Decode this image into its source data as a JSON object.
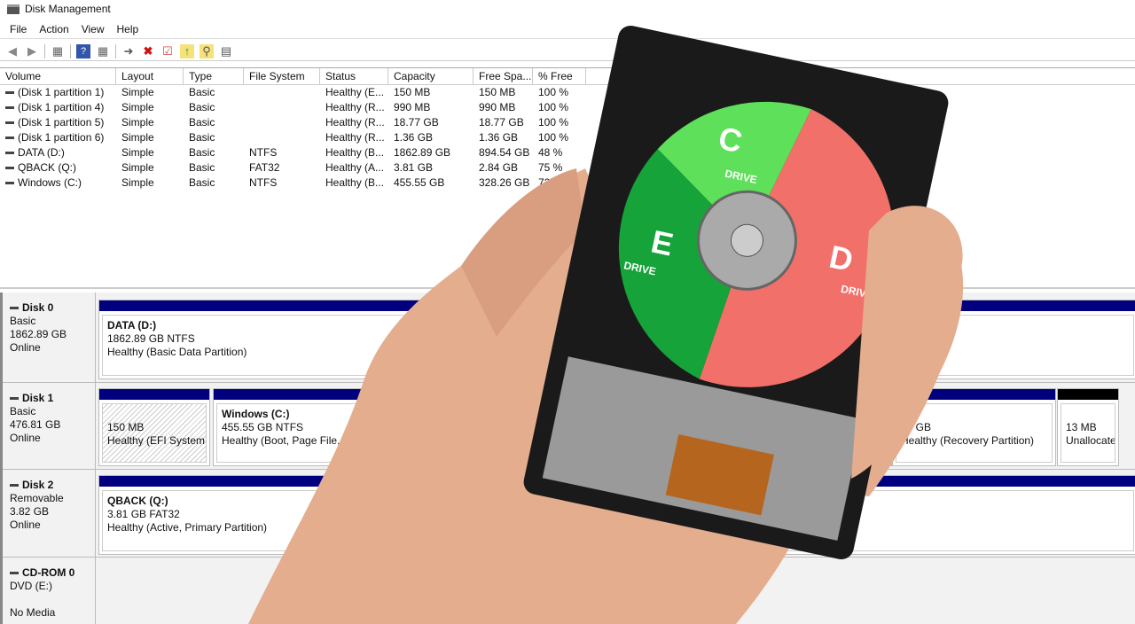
{
  "window": {
    "title": "Disk Management"
  },
  "menu": [
    "File",
    "Action",
    "View",
    "Help"
  ],
  "toolbar": {
    "icons": [
      "back-icon",
      "forward-icon",
      "console-tree-icon",
      "help-icon",
      "properties-icon",
      "connect-icon",
      "delete-icon",
      "check-icon",
      "export-icon",
      "search-icon",
      "settings-icon"
    ],
    "delete_color": "#d01010"
  },
  "volume_list": {
    "columns": [
      "Volume",
      "Layout",
      "Type",
      "File System",
      "Status",
      "Capacity",
      "Free Spa...",
      "% Free"
    ],
    "rows": [
      [
        "(Disk 1 partition 1)",
        "Simple",
        "Basic",
        "",
        "Healthy (E...",
        "150 MB",
        "150 MB",
        "100 %"
      ],
      [
        "(Disk 1 partition 4)",
        "Simple",
        "Basic",
        "",
        "Healthy (R...",
        "990 MB",
        "990 MB",
        "100 %"
      ],
      [
        "(Disk 1 partition 5)",
        "Simple",
        "Basic",
        "",
        "Healthy (R...",
        "18.77 GB",
        "18.77 GB",
        "100 %"
      ],
      [
        "(Disk 1 partition 6)",
        "Simple",
        "Basic",
        "",
        "Healthy (R...",
        "1.36 GB",
        "1.36 GB",
        "100 %"
      ],
      [
        "DATA (D:)",
        "Simple",
        "Basic",
        "NTFS",
        "Healthy (B...",
        "1862.89 GB",
        "894.54 GB",
        "48 %"
      ],
      [
        "QBACK (Q:)",
        "Simple",
        "Basic",
        "FAT32",
        "Healthy (A...",
        "3.81 GB",
        "2.84 GB",
        "75 %"
      ],
      [
        "Windows (C:)",
        "Simple",
        "Basic",
        "NTFS",
        "Healthy (B...",
        "455.55 GB",
        "328.26 GB",
        "72 %"
      ]
    ]
  },
  "disks": [
    {
      "name": "Disk 0",
      "type": "Basic",
      "size": "1862.89 GB",
      "state": "Online",
      "partitions": [
        {
          "title": "DATA  (D:)",
          "size": "1862.89 GB NTFS",
          "status": "Healthy (Basic Data Partition)"
        }
      ]
    },
    {
      "name": "Disk 1",
      "type": "Basic",
      "size": "476.81 GB",
      "state": "Online",
      "partitions": [
        {
          "title": "",
          "size": "150 MB",
          "status": "Healthy (EFI System P"
        },
        {
          "title": "Windows  (C:)",
          "size": "455.55 GB NTFS",
          "status": "Healthy (Boot, Page File, Cr"
        },
        {
          "title": "",
          "size": "36 GB",
          "status": "Healthy (Recovery Partition)"
        },
        {
          "title": "",
          "size": "13 MB",
          "status": "Unallocate"
        }
      ]
    },
    {
      "name": "Disk 2",
      "type": "Removable",
      "size": "3.82 GB",
      "state": "Online",
      "partitions": [
        {
          "title": "QBACK  (Q:)",
          "size": "3.81 GB FAT32",
          "status": "Healthy (Active, Primary Partition)"
        }
      ]
    },
    {
      "name": "CD-ROM 0",
      "type": "DVD (E:)",
      "size": "",
      "state": "No Media",
      "partitions": []
    }
  ],
  "overlay": {
    "labels": {
      "c": "C",
      "c_sub": "DRIVE",
      "d": "D",
      "d_sub": "DRIVE",
      "e": "E",
      "e_sub": "DRIVE"
    },
    "colors": {
      "c": "#5ee05a",
      "d": "#f2706a",
      "e": "#16a33a",
      "skin": "#e7b294",
      "drive": "#1a1a1a",
      "primary_bar": "#00007f",
      "unallocated_bar": "#000000"
    }
  }
}
